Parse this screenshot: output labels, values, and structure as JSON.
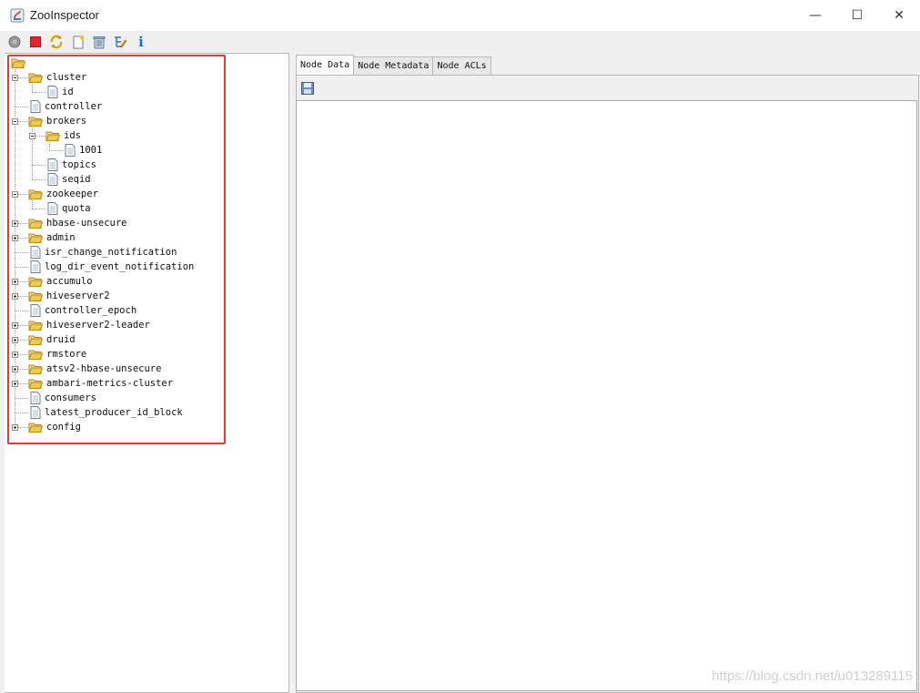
{
  "window": {
    "title": "ZooInspector",
    "minimize_glyph": "—",
    "maximize_glyph": "☐",
    "close_glyph": "✕"
  },
  "toolbar": {
    "buttons": [
      {
        "name": "connect-button",
        "icon": "connect-icon"
      },
      {
        "name": "disconnect-button",
        "icon": "stop-icon"
      },
      {
        "name": "refresh-button",
        "icon": "refresh-icon"
      },
      {
        "name": "add-node-button",
        "icon": "new-document-icon"
      },
      {
        "name": "delete-node-button",
        "icon": "trash-icon"
      },
      {
        "name": "edit-node-viewers-button",
        "icon": "edit-tree-icon"
      },
      {
        "name": "about-button",
        "icon": "info-icon",
        "label": "i"
      }
    ]
  },
  "tree": {
    "nodes": [
      {
        "label": "",
        "type": "folder",
        "depth": 0
      },
      {
        "label": "cluster",
        "type": "folder",
        "depth": 1,
        "expanded": true
      },
      {
        "label": "id",
        "type": "file",
        "depth": 2
      },
      {
        "label": "controller",
        "type": "file",
        "depth": 1
      },
      {
        "label": "brokers",
        "type": "folder",
        "depth": 1,
        "expanded": true
      },
      {
        "label": "ids",
        "type": "folder",
        "depth": 2,
        "expanded": true
      },
      {
        "label": "1001",
        "type": "file",
        "depth": 3
      },
      {
        "label": "topics",
        "type": "file",
        "depth": 2
      },
      {
        "label": "seqid",
        "type": "file",
        "depth": 2
      },
      {
        "label": "zookeeper",
        "type": "folder",
        "depth": 1,
        "expanded": true
      },
      {
        "label": "quota",
        "type": "file",
        "depth": 2
      },
      {
        "label": "hbase-unsecure",
        "type": "folder",
        "depth": 1,
        "expanded": false
      },
      {
        "label": "admin",
        "type": "folder",
        "depth": 1,
        "expanded": false
      },
      {
        "label": "isr_change_notification",
        "type": "file",
        "depth": 1
      },
      {
        "label": "log_dir_event_notification",
        "type": "file",
        "depth": 1
      },
      {
        "label": "accumulo",
        "type": "folder",
        "depth": 1,
        "expanded": false
      },
      {
        "label": "hiveserver2",
        "type": "folder",
        "depth": 1,
        "expanded": false
      },
      {
        "label": "controller_epoch",
        "type": "file",
        "depth": 1
      },
      {
        "label": "hiveserver2-leader",
        "type": "folder",
        "depth": 1,
        "expanded": false
      },
      {
        "label": "druid",
        "type": "folder",
        "depth": 1,
        "expanded": false
      },
      {
        "label": "rmstore",
        "type": "folder",
        "depth": 1,
        "expanded": false
      },
      {
        "label": "atsv2-hbase-unsecure",
        "type": "folder",
        "depth": 1,
        "expanded": false
      },
      {
        "label": "ambari-metrics-cluster",
        "type": "folder",
        "depth": 1,
        "expanded": false
      },
      {
        "label": "consumers",
        "type": "file",
        "depth": 1
      },
      {
        "label": "latest_producer_id_block",
        "type": "file",
        "depth": 1
      },
      {
        "label": "config",
        "type": "folder",
        "depth": 1,
        "expanded": false
      }
    ]
  },
  "tabs": [
    {
      "label": "Node Data",
      "active": true
    },
    {
      "label": "Node Metadata",
      "active": false
    },
    {
      "label": "Node ACLs",
      "active": false
    }
  ],
  "editor": {
    "value": ""
  },
  "watermark": "https://blog.csdn.net/u013289115",
  "colors": {
    "highlight": "#e53935",
    "folder": "#f0c85a",
    "accent": "#1f6fbf"
  }
}
